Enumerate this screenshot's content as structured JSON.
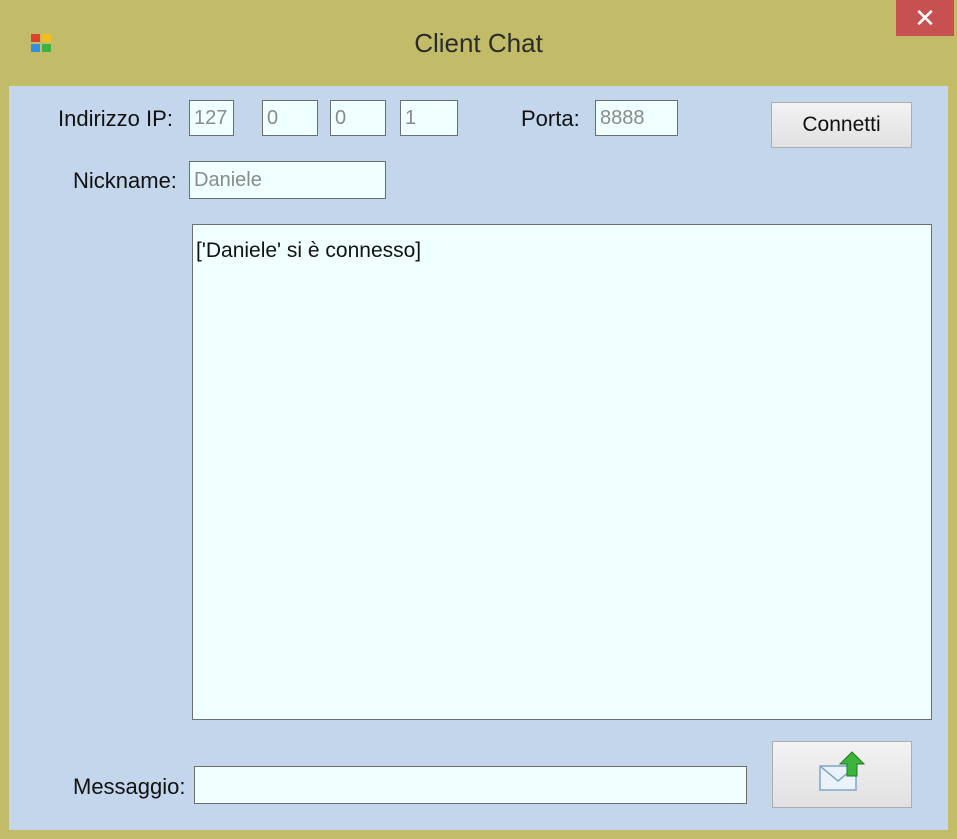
{
  "window": {
    "title": "Client Chat",
    "close_glyph": "✕",
    "app_icon": "windows-app-icon"
  },
  "form": {
    "ip_label": "Indirizzo IP:",
    "ip_octets": [
      "127",
      "0",
      "0",
      "1"
    ],
    "port_label": "Porta:",
    "port_value": "8888",
    "connect_label": "Connetti",
    "nickname_label": "Nickname:",
    "nickname_value": "Daniele",
    "message_label": "Messaggio:",
    "message_value": "",
    "send_icon": "envelope-send-icon"
  },
  "chat": {
    "lines": [
      "['Daniele' si è connesso]"
    ]
  },
  "colors": {
    "titlebar": "#c2bc68",
    "client": "#c3d6ec",
    "field_bg": "#f0ffff",
    "close": "#c75050"
  }
}
